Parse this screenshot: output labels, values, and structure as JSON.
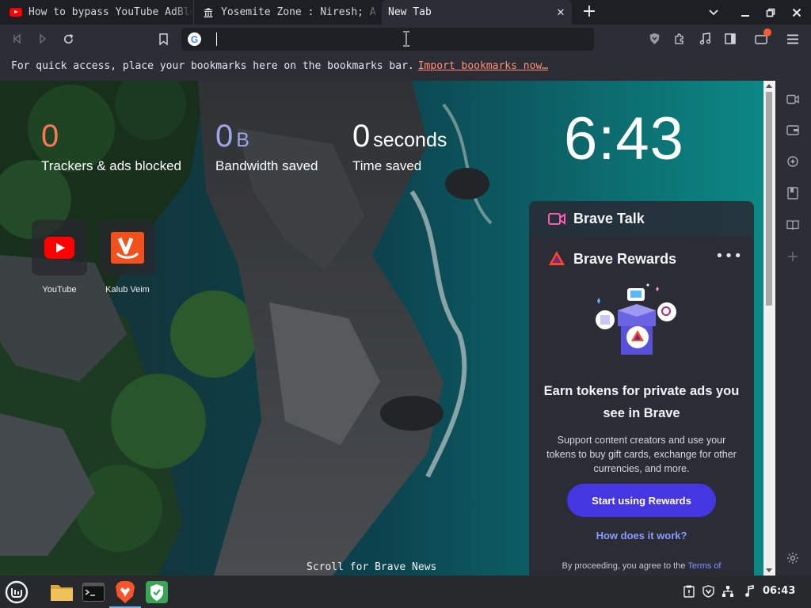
{
  "tabs": [
    {
      "title": "How to bypass YouTube AdBlock",
      "favicon": "youtube-icon"
    },
    {
      "title": "Yosemite Zone : Niresh; A",
      "favicon": "bank-icon"
    },
    {
      "title": "New Tab",
      "favicon": "none"
    }
  ],
  "toolbar": {
    "omnibox_value": "",
    "search_engine_icon": "google-icon"
  },
  "bookmarks_bar": {
    "message": "For quick access, place your bookmarks here on the bookmarks bar.",
    "import_link": "Import bookmarks now…"
  },
  "stats": {
    "trackers": {
      "value": "0",
      "label": "Trackers & ads blocked"
    },
    "bandwidth": {
      "value": "0",
      "unit": "B",
      "label": "Bandwidth saved"
    },
    "time": {
      "value": "0",
      "unit": "seconds",
      "label": "Time saved"
    }
  },
  "clock": "6:43",
  "top_sites": [
    {
      "name": "YouTube",
      "icon": "youtube-icon"
    },
    {
      "name": "Kalub Veim",
      "icon": "v-logo-icon"
    }
  ],
  "brave_talk": {
    "title": "Brave Talk"
  },
  "brave_rewards": {
    "title": "Brave Rewards",
    "headline": "Earn tokens for private ads you see in Brave",
    "body": "Support content creators and use your tokens to buy gift cards, exchange for other currencies, and more.",
    "cta": "Start using Rewards",
    "how_link": "How does it work?",
    "terms_prefix": "By proceeding, you agree to the",
    "terms_link": "Terms of"
  },
  "scroll_hint": "Scroll for Brave News",
  "taskbar": {
    "time": "06:43"
  },
  "colors": {
    "trackers": "#ff7654",
    "bandwidth": "#a0a5eb",
    "accent_button": "#4436e0",
    "link": "#8a9cff"
  }
}
